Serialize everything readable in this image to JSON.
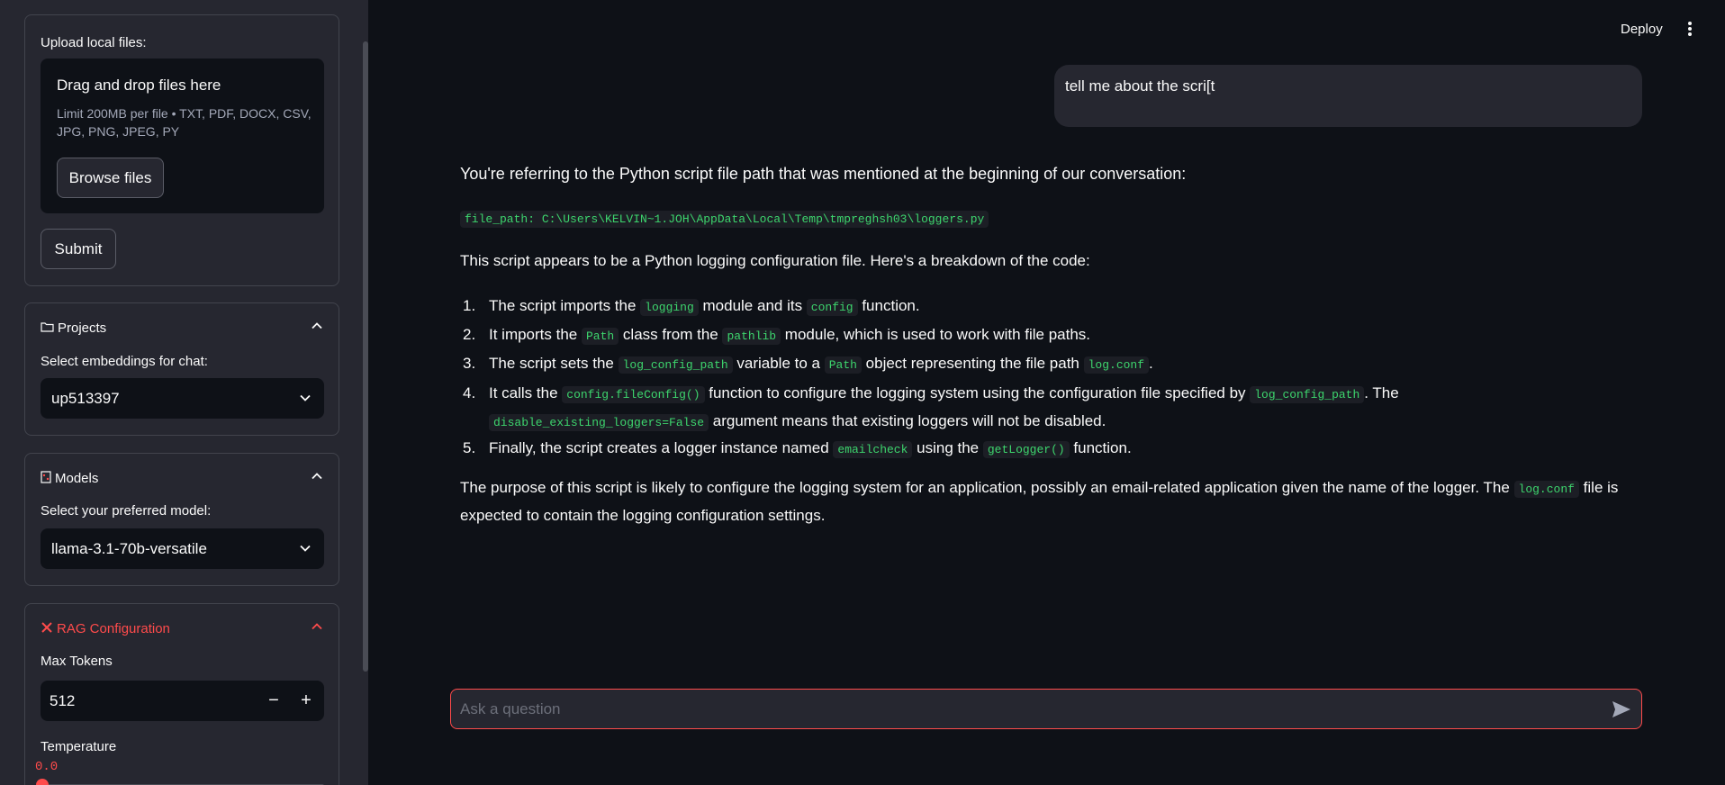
{
  "sidebar": {
    "upload": {
      "label": "Upload local files:",
      "drop_title": "Drag and drop files here",
      "drop_sub": "Limit 200MB per file • TXT, PDF, DOCX, CSV, JPG, PNG, JPEG, PY",
      "browse_label": "Browse files",
      "submit_label": "Submit"
    },
    "projects": {
      "icon": "folder-icon",
      "title": "Projects",
      "select_label": "Select embeddings for chat:",
      "selected": "up513397"
    },
    "models": {
      "icon": "abacus-icon",
      "title": "Models",
      "select_label": "Select your preferred model:",
      "selected": "llama-3.1-70b-versatile"
    },
    "rag": {
      "icon": "tools-icon",
      "title": "RAG Configuration",
      "max_tokens_label": "Max Tokens",
      "max_tokens_value": "512",
      "temperature_label": "Temperature",
      "temperature_value": "0.0",
      "temperature_fraction": 0.0
    }
  },
  "header": {
    "deploy_label": "Deploy"
  },
  "chat": {
    "user_message": "tell me about the scri[t",
    "answer": {
      "intro": "You're referring to the Python script file path that was mentioned at the beginning of our conversation:",
      "code_path": "file_path: C:\\Users\\KELVIN~1.JOH\\AppData\\Local\\Temp\\tmpreghsh03\\loggers.py",
      "breakdown_intro": "This script appears to be a Python logging configuration file. Here's a breakdown of the code:",
      "items": [
        {
          "n": "1.",
          "a": "The script imports the ",
          "c1": "logging",
          "b": " module and its ",
          "c2": "config",
          "d": " function."
        },
        {
          "n": "2.",
          "a": "It imports the ",
          "c1": "Path",
          "b": " class from the ",
          "c2": "pathlib",
          "d": " module, which is used to work with file paths."
        },
        {
          "n": "3.",
          "a": "The script sets the ",
          "c1": "log_config_path",
          "b": " variable to a ",
          "c2": "Path",
          "d": " object representing the file path ",
          "c3": "log.conf",
          "e": "."
        },
        {
          "n": "4.",
          "a": "It calls the ",
          "c1": "config.fileConfig()",
          "b": " function to configure the logging system using the configuration file specified by ",
          "c2": "log_config_path",
          "d": ". The ",
          "c3": "disable_existing_loggers=False",
          "e": " argument means that existing loggers will not be disabled."
        },
        {
          "n": "5.",
          "a": "Finally, the script creates a logger instance named ",
          "c1": "emailcheck",
          "b": " using the ",
          "c2": "getLogger()",
          "d": " function."
        }
      ],
      "purpose_a": "The purpose of this script is likely to configure the logging system for an application, possibly an email-related application given the name of the logger. The ",
      "purpose_code": "log.conf",
      "purpose_b": " file is expected to contain the logging configuration settings."
    },
    "input_placeholder": "Ask a question"
  },
  "colors": {
    "accent": "#ff4b4b",
    "code_green": "#3dd56d",
    "bg": "#0e1117",
    "sidebar_bg": "#262730"
  }
}
